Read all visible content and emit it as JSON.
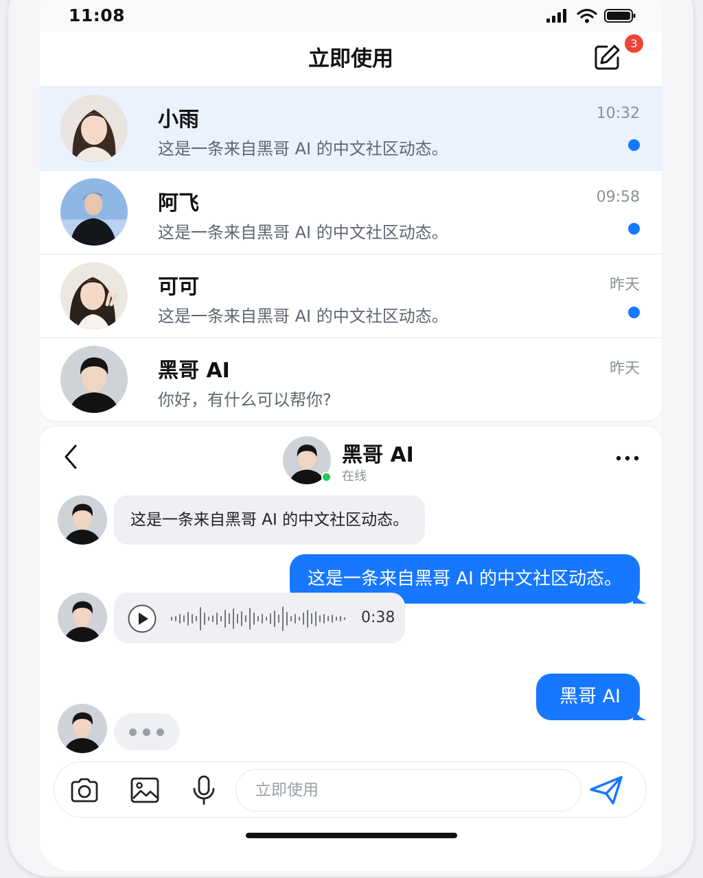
{
  "status_bar": {
    "time": "11:08",
    "icons": [
      "signal-icon",
      "wifi-icon",
      "battery-icon"
    ]
  },
  "header": {
    "title": "立即使用",
    "compose_icon": "compose-icon",
    "badge_count": "3"
  },
  "conversations": [
    {
      "name": "小雨",
      "preview": "这是一条来自黑哥 AI 的中文社区动态。",
      "time": "10:32",
      "unread": true,
      "highlighted": true
    },
    {
      "name": "阿飞",
      "preview": "这是一条来自黑哥 AI 的中文社区动态。",
      "time": "09:58",
      "unread": true,
      "highlighted": false
    },
    {
      "name": "可可",
      "preview": "这是一条来自黑哥 AI 的中文社区动态。",
      "time": "昨天",
      "unread": true,
      "highlighted": false
    },
    {
      "name": "黑哥 AI",
      "preview": "你好，有什么可以帮你?",
      "time": "昨天",
      "unread": false,
      "highlighted": false
    }
  ],
  "chat": {
    "name": "黑哥 AI",
    "status": "在线",
    "messages": [
      {
        "direction": "incoming",
        "type": "text",
        "text": "这是一条来自黑哥 AI 的中文社区动态。"
      },
      {
        "direction": "outgoing",
        "type": "text",
        "text": "这是一条来自黑哥 AI 的中文社区动态。"
      },
      {
        "direction": "incoming",
        "type": "voice",
        "duration": "0:38"
      },
      {
        "direction": "outgoing",
        "type": "text",
        "text": "黑哥 AI"
      },
      {
        "direction": "incoming",
        "type": "typing"
      }
    ]
  },
  "input_bar": {
    "placeholder": "立即使用",
    "tools": [
      "camera-icon",
      "image-icon",
      "microphone-icon"
    ],
    "send_icon": "send-icon"
  },
  "colors": {
    "accent": "#1677ff",
    "badge": "#f04438",
    "online": "#22c55e",
    "highlight_row": "#eaf2fd",
    "incoming_bubble": "#eef0f3"
  }
}
